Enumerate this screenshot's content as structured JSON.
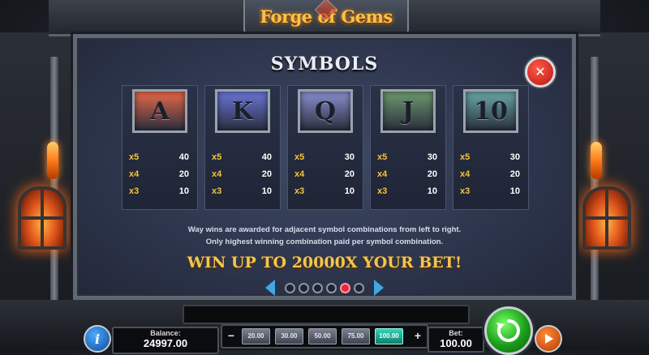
{
  "logo": "Forge of Gems",
  "panel": {
    "title": "SYMBOLS",
    "close_icon": "close-icon"
  },
  "symbols": [
    {
      "letter": "A",
      "color": "#e8684a",
      "pays": [
        {
          "mult": "x5",
          "value": "40"
        },
        {
          "mult": "x4",
          "value": "20"
        },
        {
          "mult": "x3",
          "value": "10"
        }
      ]
    },
    {
      "letter": "K",
      "color": "#6a76d8",
      "pays": [
        {
          "mult": "x5",
          "value": "40"
        },
        {
          "mult": "x4",
          "value": "20"
        },
        {
          "mult": "x3",
          "value": "10"
        }
      ]
    },
    {
      "letter": "Q",
      "color": "#8a8fd0",
      "pays": [
        {
          "mult": "x5",
          "value": "30"
        },
        {
          "mult": "x4",
          "value": "20"
        },
        {
          "mult": "x3",
          "value": "10"
        }
      ]
    },
    {
      "letter": "J",
      "color": "#6e9a6e",
      "pays": [
        {
          "mult": "x5",
          "value": "30"
        },
        {
          "mult": "x4",
          "value": "20"
        },
        {
          "mult": "x3",
          "value": "10"
        }
      ]
    },
    {
      "letter": "10",
      "color": "#6aa8a8",
      "pays": [
        {
          "mult": "x5",
          "value": "30"
        },
        {
          "mult": "x4",
          "value": "20"
        },
        {
          "mult": "x3",
          "value": "10"
        }
      ]
    }
  ],
  "description": {
    "line1": "Way wins are awarded for adjacent symbol combinations from left to right.",
    "line2": "Only highest winning combination paid per symbol combination."
  },
  "win_text": "WIN UP TO 20000X YOUR BET!",
  "pager": {
    "pages": 6,
    "active": 5
  },
  "bottom": {
    "balance_label": "Balance:",
    "balance_value": "24997.00",
    "bet_options": [
      "20.00",
      "30.00",
      "50.00",
      "75.00",
      "100.00"
    ],
    "bet_selected": 4,
    "bet_minus": "−",
    "bet_plus": "+",
    "bet_label": "Bet:",
    "bet_value": "100.00"
  },
  "colors": {
    "accent_gold": "#f5c64c",
    "spin_green": "#1a9e1a",
    "close_red": "#b8160e",
    "arrow_blue": "#3fa9e8"
  }
}
